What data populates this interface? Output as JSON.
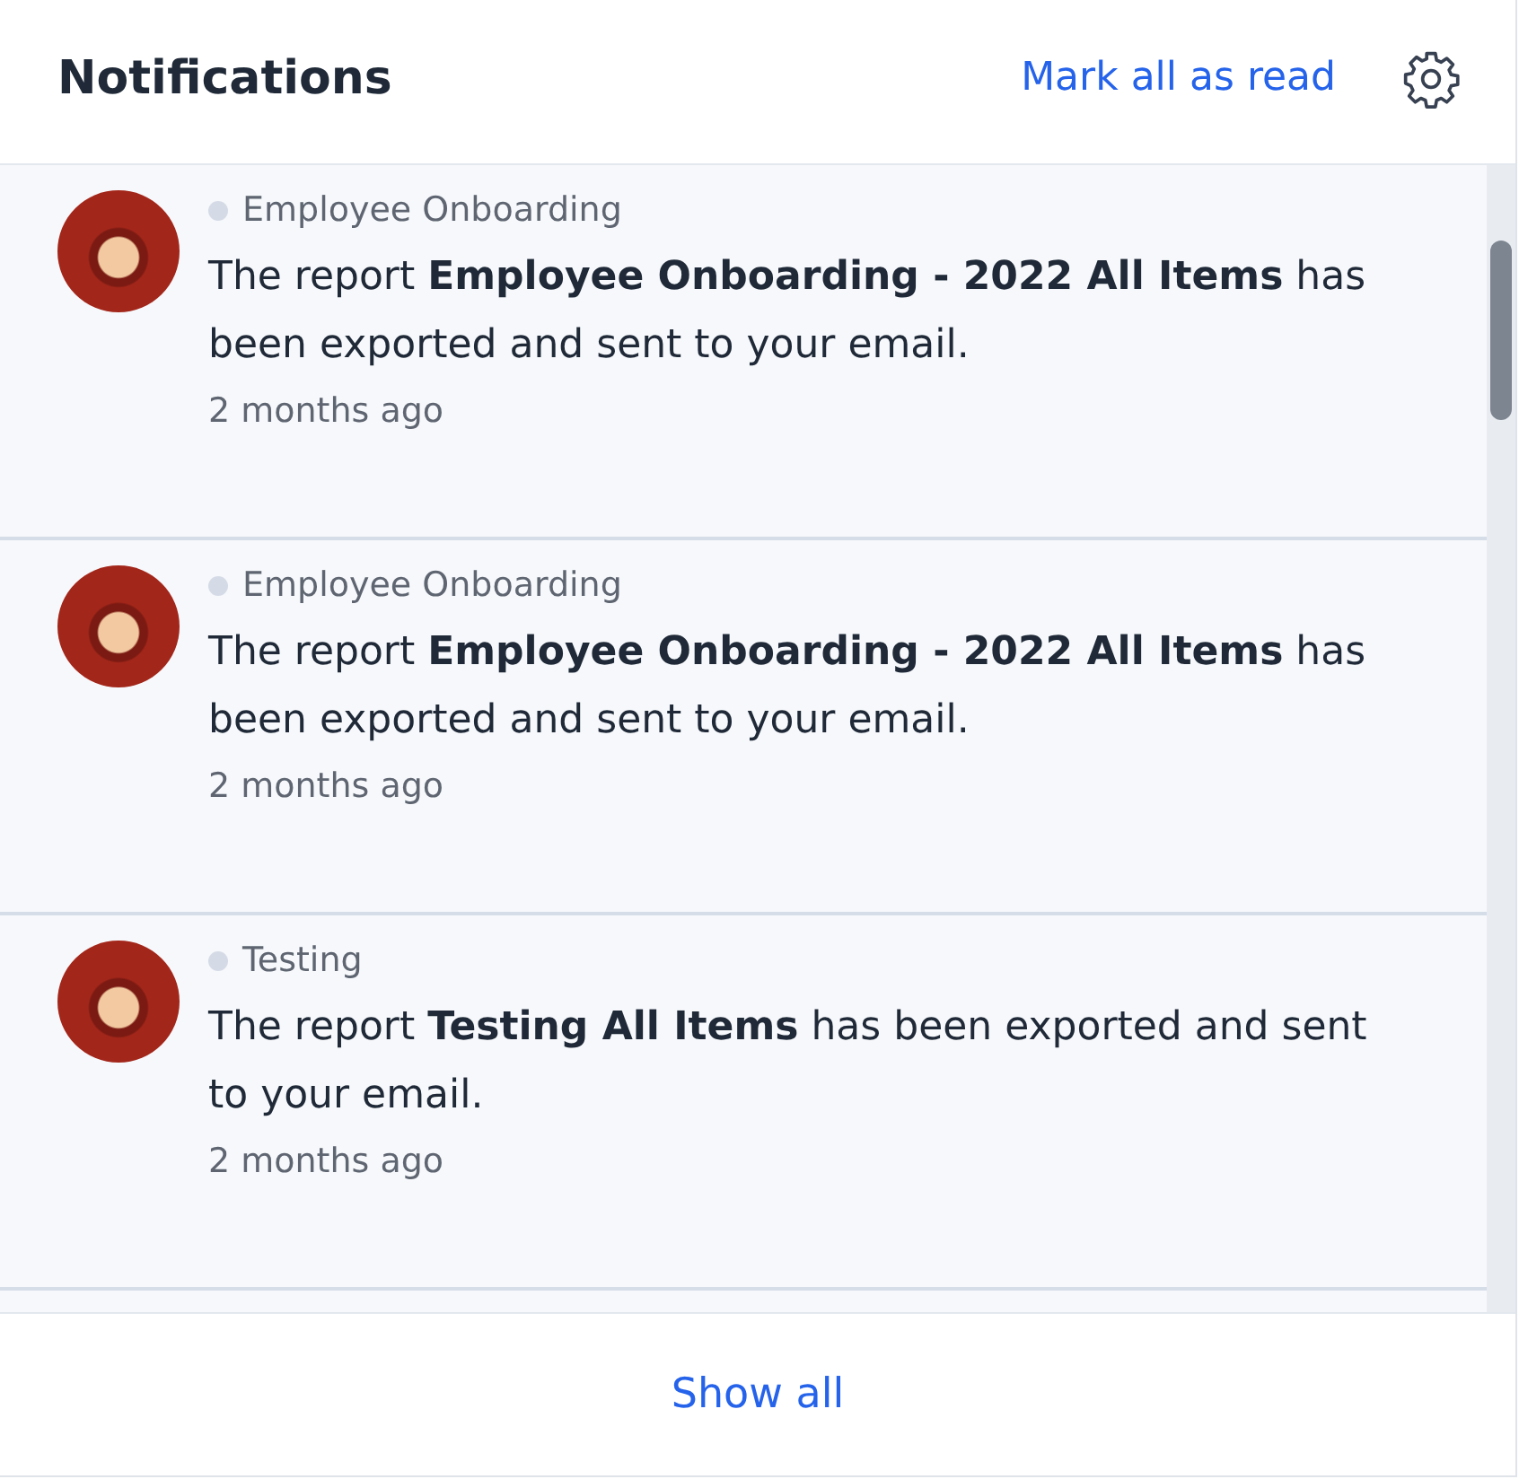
{
  "header": {
    "title": "Notifications",
    "mark_all": "Mark all as read"
  },
  "notifications": [
    {
      "source": "Employee Onboarding",
      "unread": false,
      "message": "The report **Employee Onboarding - 2022 All Items** has been exported and sent to your email.",
      "time": "2 months ago"
    },
    {
      "source": "Employee Onboarding",
      "unread": false,
      "message": "The report **Employee Onboarding - 2022 All Items** has been exported and sent to your email.",
      "time": "2 months ago"
    },
    {
      "source": "Testing",
      "unread": false,
      "message": "The report **Testing All Items** has been exported and sent to your email.",
      "time": "2 months ago"
    }
  ],
  "footer": {
    "show_all": "Show all"
  }
}
